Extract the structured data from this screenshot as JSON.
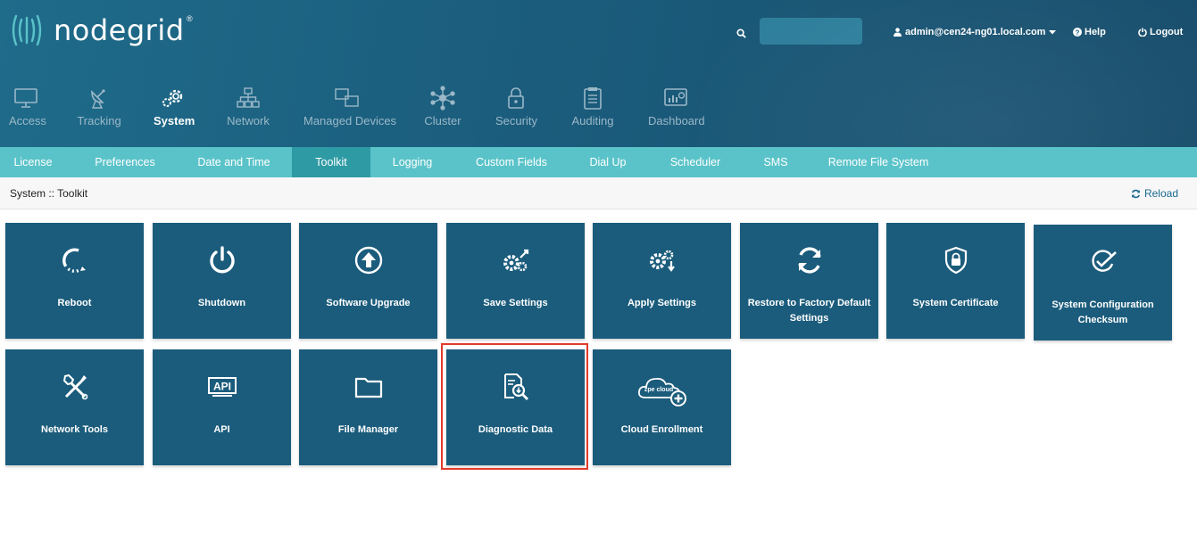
{
  "brand": {
    "name": "nodegrid",
    "registered": "®"
  },
  "header": {
    "search": {
      "placeholder": "",
      "value": ""
    },
    "user": "admin@cen24-ng01.local.com",
    "help": "Help",
    "logout": "Logout"
  },
  "mainnav": [
    {
      "label": "Access",
      "icon": "monitor-icon",
      "active": false
    },
    {
      "label": "Tracking",
      "icon": "satellite-icon",
      "active": false
    },
    {
      "label": "System",
      "icon": "gears-icon",
      "active": true
    },
    {
      "label": "Network",
      "icon": "network-icon",
      "active": false
    },
    {
      "label": "Managed Devices",
      "icon": "devices-icon",
      "active": false
    },
    {
      "label": "Cluster",
      "icon": "cluster-icon",
      "active": false
    },
    {
      "label": "Security",
      "icon": "lock-icon",
      "active": false
    },
    {
      "label": "Auditing",
      "icon": "clipboard-icon",
      "active": false
    },
    {
      "label": "Dashboard",
      "icon": "dashboard-icon",
      "active": false
    }
  ],
  "subnav": [
    {
      "label": "License",
      "active": false
    },
    {
      "label": "Preferences",
      "active": false
    },
    {
      "label": "Date and Time",
      "active": false
    },
    {
      "label": "Toolkit",
      "active": true
    },
    {
      "label": "Logging",
      "active": false
    },
    {
      "label": "Custom Fields",
      "active": false
    },
    {
      "label": "Dial Up",
      "active": false
    },
    {
      "label": "Scheduler",
      "active": false
    },
    {
      "label": "SMS",
      "active": false
    },
    {
      "label": "Remote File System",
      "active": false
    }
  ],
  "breadcrumb": "System :: Toolkit",
  "reload": "Reload",
  "tiles": [
    {
      "label": "Reboot",
      "icon": "reboot-icon"
    },
    {
      "label": "Shutdown",
      "icon": "power-icon"
    },
    {
      "label": "Software Upgrade",
      "icon": "upgrade-arrow-icon"
    },
    {
      "label": "Save Settings",
      "icon": "save-gears-icon"
    },
    {
      "label": "Apply Settings",
      "icon": "apply-gears-icon"
    },
    {
      "label": "Restore to Factory Default Settings",
      "icon": "restore-icon"
    },
    {
      "label": "System Certificate",
      "icon": "shield-lock-icon"
    },
    {
      "label": "System Configuration Checksum",
      "icon": "checksum-icon"
    },
    {
      "label": "Network Tools",
      "icon": "tools-icon"
    },
    {
      "label": "API",
      "icon": "api-icon"
    },
    {
      "label": "File Manager",
      "icon": "folder-icon"
    },
    {
      "label": "Diagnostic Data",
      "icon": "diagnostic-doc-icon"
    },
    {
      "label": "Cloud Enrollment",
      "icon": "cloud-plus-icon",
      "cloud_text": "zpe cloud"
    }
  ],
  "colors": {
    "header": "#1b5c7c",
    "subnav": "#5ac3c9",
    "tile": "#1b5c7c",
    "highlight": "#e23a2b"
  }
}
